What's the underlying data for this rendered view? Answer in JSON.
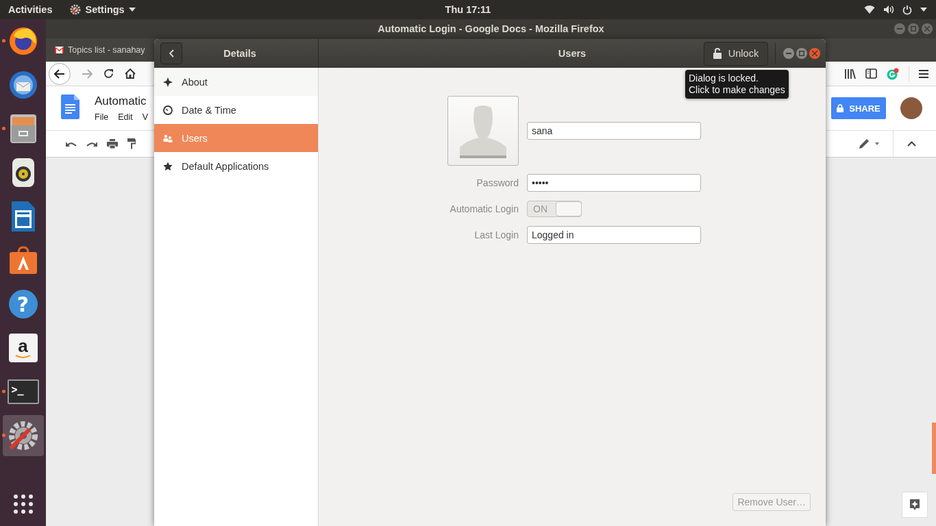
{
  "top_bar": {
    "activities": "Activities",
    "app_menu": "Settings",
    "clock": "Thu 17:11"
  },
  "dock": {
    "items": [
      {
        "kind": "browser",
        "running": true,
        "selected": false
      },
      {
        "kind": "mail",
        "running": false,
        "selected": false
      },
      {
        "kind": "files",
        "running": true,
        "selected": false
      },
      {
        "kind": "music",
        "running": false,
        "selected": false
      },
      {
        "kind": "writer",
        "running": false,
        "selected": false
      },
      {
        "kind": "software",
        "running": false,
        "selected": false
      },
      {
        "kind": "help",
        "glyph": "?",
        "running": false,
        "selected": false
      },
      {
        "kind": "amazon",
        "glyph": "a",
        "running": false,
        "selected": false
      },
      {
        "kind": "terminal",
        "glyph": ">_",
        "running": true,
        "selected": false
      },
      {
        "kind": "settings",
        "running": true,
        "selected": true
      }
    ]
  },
  "browser": {
    "title": "Automatic Login - Google Docs - Mozilla Firefox",
    "tab": {
      "label": "Topics list - sanahay"
    },
    "document": {
      "title": "Automatic",
      "menus": [
        "File",
        "Edit",
        "V"
      ],
      "share": "SHARE"
    }
  },
  "dialog": {
    "sidebar_title": "Details",
    "title": "Users",
    "unlock": "Unlock",
    "tooltip": "Dialog is locked.\nClick to make changes",
    "sidebar": [
      {
        "kind": "about",
        "label": "About",
        "selected": false
      },
      {
        "kind": "clock",
        "label": "Date & Time",
        "selected": false
      },
      {
        "kind": "users",
        "label": "Users",
        "selected": true
      },
      {
        "kind": "star",
        "label": "Default Applications",
        "selected": false
      }
    ],
    "user": {
      "name": "sana",
      "fields": [
        {
          "kind": "entry",
          "label": "Password",
          "value": "•••••"
        },
        {
          "kind": "switch",
          "label": "Automatic Login",
          "on": true,
          "state_text": "ON"
        },
        {
          "kind": "entry",
          "label": "Last Login",
          "value": "Logged in"
        }
      ]
    },
    "remove_button": {
      "label": "Remove User…",
      "disabled": true
    }
  }
}
